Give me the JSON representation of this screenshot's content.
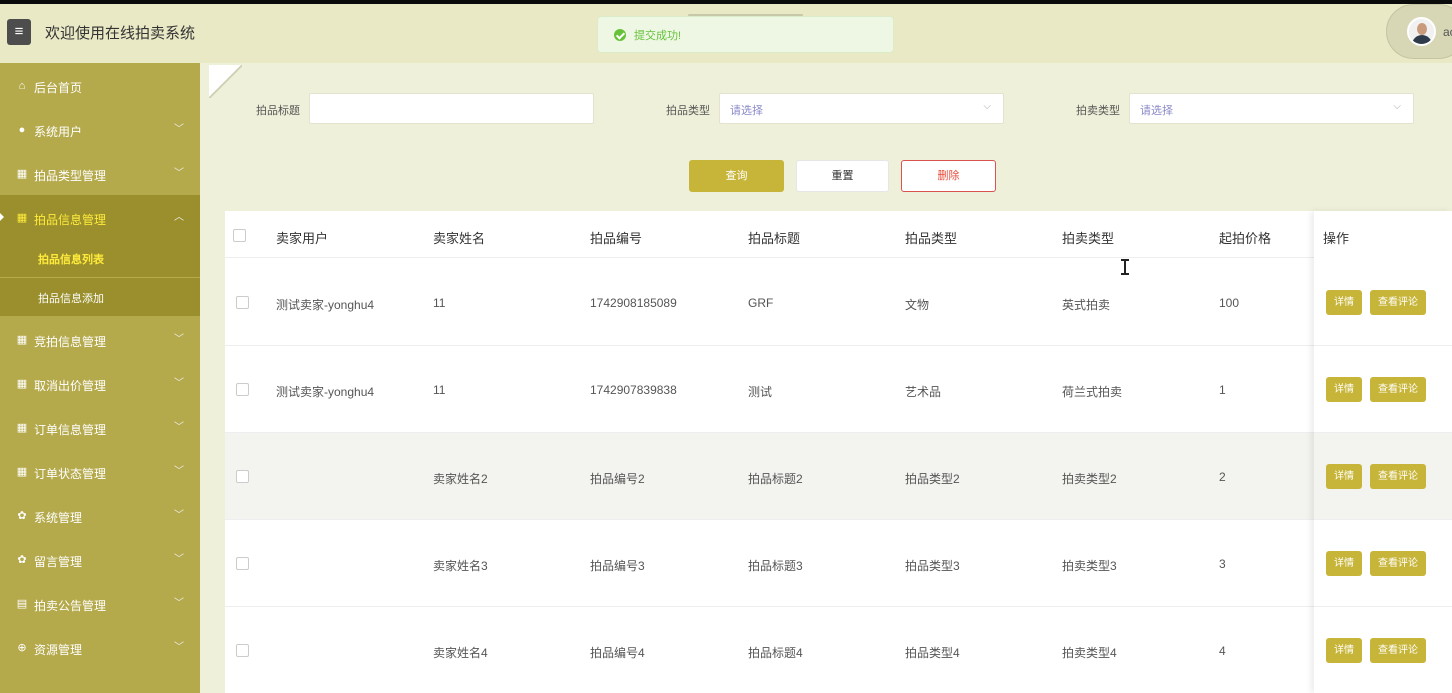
{
  "app": {
    "title": "欢迎使用在线拍卖系统",
    "menu_icon": "hamburger-icon"
  },
  "toast": {
    "message": "提交成功!",
    "color": "#67c23a"
  },
  "user": {
    "name": "ac"
  },
  "sidebar": {
    "items": [
      {
        "label": "后台首页",
        "icon": "home-icon"
      },
      {
        "label": "系统用户",
        "icon": "user-icon"
      },
      {
        "label": "拍品类型管理",
        "icon": "grid-icon"
      },
      {
        "label": "拍品信息管理",
        "icon": "grid-icon",
        "active": true
      },
      {
        "label": "竞拍信息管理",
        "icon": "grid-icon"
      },
      {
        "label": "取消出价管理",
        "icon": "grid-icon"
      },
      {
        "label": "订单信息管理",
        "icon": "grid-icon"
      },
      {
        "label": "订单状态管理",
        "icon": "grid-icon"
      },
      {
        "label": "系统管理",
        "icon": "gear-icon"
      },
      {
        "label": "留言管理",
        "icon": "gear-icon"
      },
      {
        "label": "拍卖公告管理",
        "icon": "doc-icon"
      },
      {
        "label": "资源管理",
        "icon": "plus-circle-icon"
      }
    ],
    "sub_items": [
      {
        "label": "拍品信息列表",
        "current": true
      },
      {
        "label": "拍品信息添加"
      }
    ]
  },
  "filters": {
    "title_label": "拍品标题",
    "title_value": "",
    "type_label": "拍品类型",
    "type_placeholder": "请选择",
    "auction_type_label": "拍卖类型",
    "auction_type_placeholder": "请选择"
  },
  "buttons": {
    "query": "查询",
    "reset": "重置",
    "delete": "删除"
  },
  "table": {
    "columns": [
      "卖家用户",
      "卖家姓名",
      "拍品编号",
      "拍品标题",
      "拍品类型",
      "拍卖类型",
      "起拍价格",
      "操作"
    ],
    "rows": [
      [
        "测试卖家-yonghu4",
        "11",
        "1742908185089",
        "GRF",
        "文物",
        "英式拍卖",
        "100"
      ],
      [
        "测试卖家-yonghu4",
        "11",
        "1742907839838",
        "测试",
        "艺术品",
        "荷兰式拍卖",
        "1"
      ],
      [
        "",
        "卖家姓名2",
        "拍品编号2",
        "拍品标题2",
        "拍品类型2",
        "拍卖类型2",
        "2"
      ],
      [
        "",
        "卖家姓名3",
        "拍品编号3",
        "拍品标题3",
        "拍品类型3",
        "拍卖类型3",
        "3"
      ],
      [
        "",
        "卖家姓名4",
        "拍品编号4",
        "拍品标题4",
        "拍品类型4",
        "拍卖类型4",
        "4"
      ]
    ],
    "row_actions": {
      "detail": "详情",
      "review": "查看评论"
    }
  },
  "theme": {
    "accent": "#c7b539",
    "sidebar": "#b4a94b",
    "sidebar_active": "#9a8f2c",
    "header": "#e9e9c6"
  }
}
